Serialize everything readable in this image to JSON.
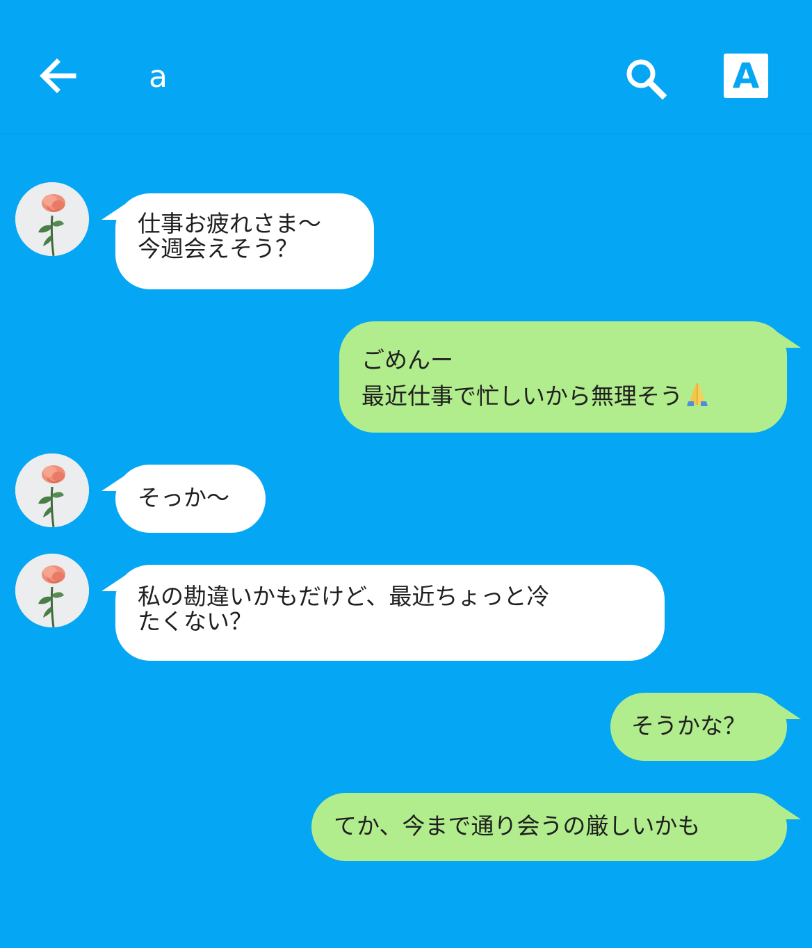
{
  "header": {
    "title": "a",
    "back_icon": "arrow-left-icon",
    "search_icon": "search-icon",
    "font_button_label": "A"
  },
  "colors": {
    "background": "#05a6f3",
    "incoming_bubble": "#ffffff",
    "outgoing_bubble": "#b2ed8d",
    "text": "#1f1f1f"
  },
  "messages": [
    {
      "direction": "incoming",
      "lines": [
        "仕事お疲れさま〜",
        "今週会えそう？"
      ]
    },
    {
      "direction": "outgoing",
      "lines": [
        "ごめんー",
        "最近仕事で忙しいから無理そう"
      ],
      "emoji": "folded-hands-icon"
    },
    {
      "direction": "incoming",
      "lines": [
        "そっか〜"
      ]
    },
    {
      "direction": "incoming",
      "lines": [
        "私の勘違いかもだけど、最近ちょっと冷",
        "たくない？"
      ]
    },
    {
      "direction": "outgoing",
      "lines": [
        "そうかな？"
      ]
    },
    {
      "direction": "outgoing",
      "lines": [
        "てか、今まで通り会うの厳しいかも"
      ]
    }
  ]
}
